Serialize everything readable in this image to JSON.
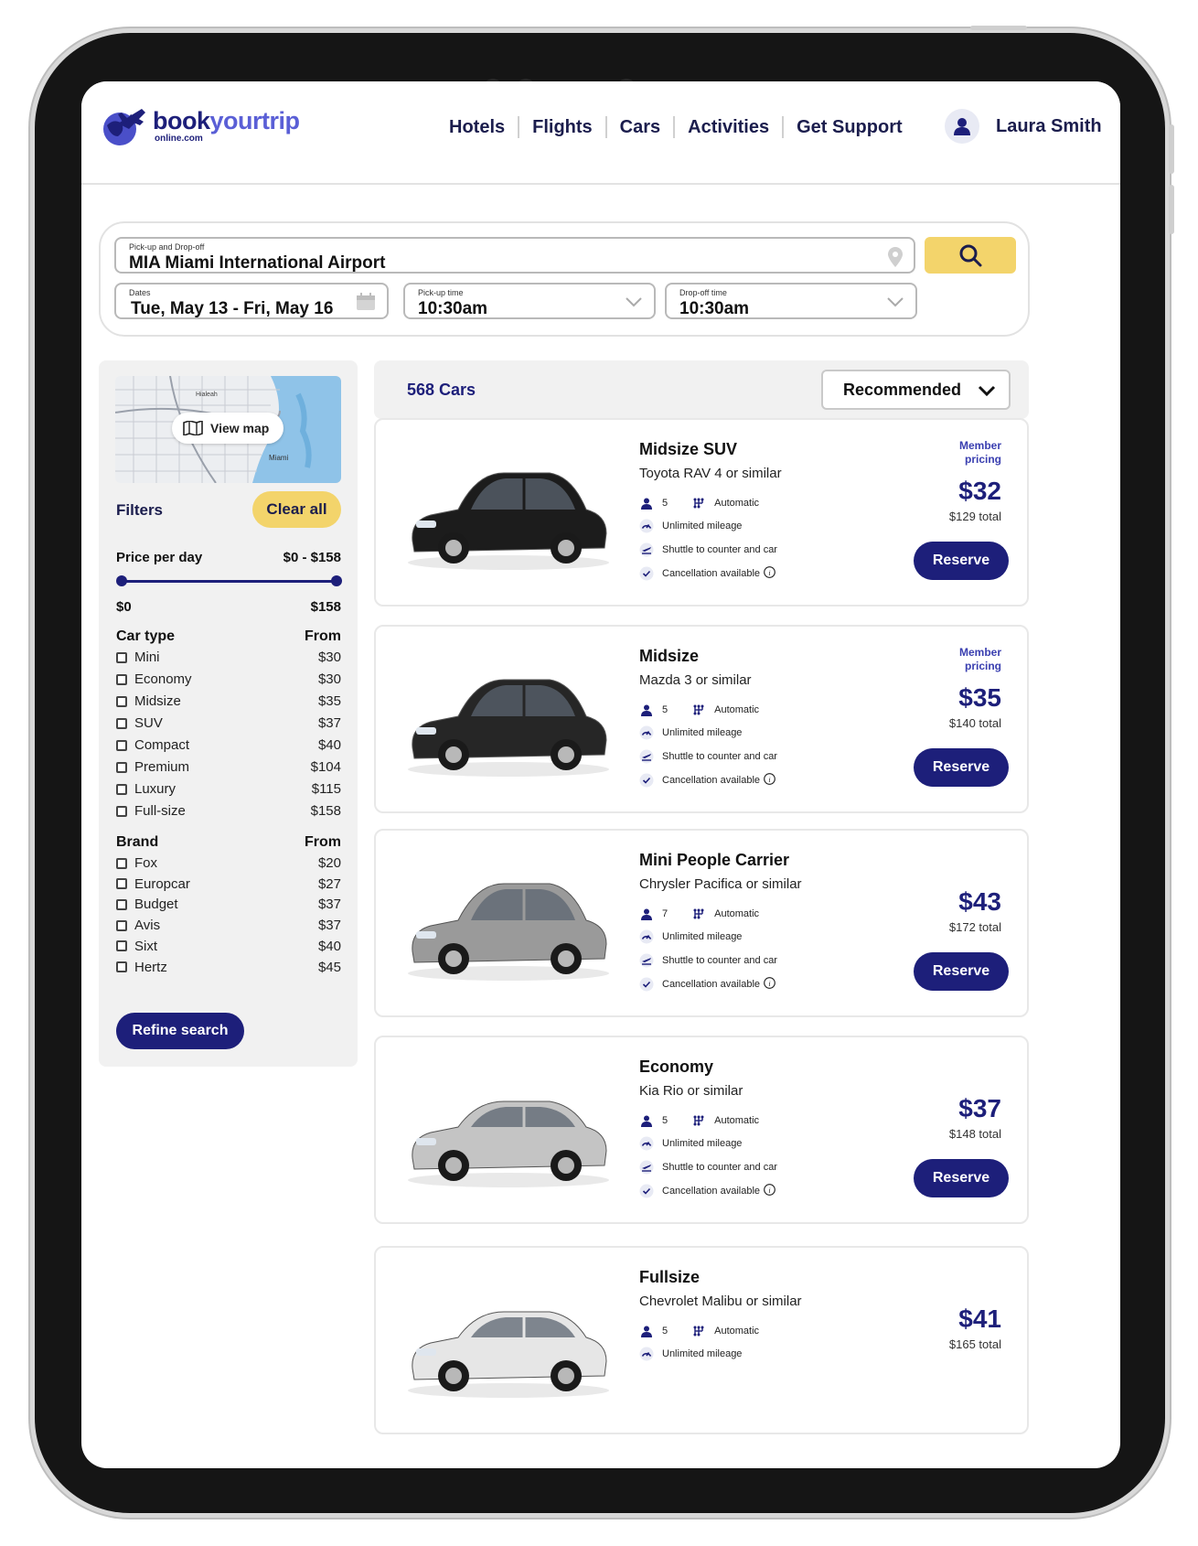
{
  "header": {
    "logo_main": "book",
    "logo_accent": "your",
    "logo_trip": "trip",
    "logo_sub": "online.com",
    "nav": [
      "Hotels",
      "Flights",
      "Cars",
      "Activities",
      "Get Support"
    ],
    "user_name": "Laura Smith"
  },
  "search": {
    "location_label": "Pick-up and Drop-off",
    "location_value": "MIA Miami International Airport",
    "dates_label": "Dates",
    "dates_value": "Tue, May 13 - Fri, May 16",
    "pickup_label": "Pick-up time",
    "pickup_value": "10:30am",
    "dropoff_label": "Drop-off time",
    "dropoff_value": "10:30am"
  },
  "sidebar": {
    "map_labels": [
      "Hialeah",
      "Miami"
    ],
    "view_map": "View map",
    "filters_title": "Filters",
    "clear_all": "Clear all",
    "price_label": "Price per day",
    "price_range": "$0 - $158",
    "price_min": "$0",
    "price_max": "$158",
    "car_type_head": "Car type",
    "brand_head": "Brand",
    "from_label": "From",
    "car_types": [
      {
        "label": "Mini",
        "price": "$30"
      },
      {
        "label": "Economy",
        "price": "$30"
      },
      {
        "label": "Midsize",
        "price": "$35"
      },
      {
        "label": "SUV",
        "price": "$37"
      },
      {
        "label": "Compact",
        "price": "$40"
      },
      {
        "label": "Premium",
        "price": "$104"
      },
      {
        "label": "Luxury",
        "price": "$115"
      },
      {
        "label": "Full-size",
        "price": "$158"
      }
    ],
    "brands": [
      {
        "label": "Fox",
        "price": "$20"
      },
      {
        "label": "Europcar",
        "price": "$27"
      },
      {
        "label": "Budget",
        "price": "$37"
      },
      {
        "label": "Avis",
        "price": "$37"
      },
      {
        "label": "Sixt",
        "price": "$40"
      },
      {
        "label": "Hertz",
        "price": "$45"
      }
    ],
    "refine": "Refine search"
  },
  "results": {
    "count": "568 Cars",
    "sort": "Recommended",
    "reserve_label": "Reserve",
    "member_line1": "Member",
    "member_line2": "pricing",
    "feature_labels": {
      "transmission": "Automatic",
      "mileage": "Unlimited mileage",
      "shuttle": "Shuttle to counter and car",
      "cancel": "Cancellation available"
    },
    "cars": [
      {
        "title": "Midsize SUV",
        "sub": "Toyota RAV 4 or similar",
        "seats": "5",
        "price": "$32",
        "total": "$129 total",
        "member": true,
        "color": "#1c1c1c"
      },
      {
        "title": "Midsize",
        "sub": "Mazda 3 or similar",
        "seats": "5",
        "price": "$35",
        "total": "$140 total",
        "member": true,
        "color": "#262626"
      },
      {
        "title": "Mini People Carrier",
        "sub": "Chrysler Pacifica or similar",
        "seats": "7",
        "price": "$43",
        "total": "$172 total",
        "member": false,
        "color": "#9a9a9a"
      },
      {
        "title": "Economy",
        "sub": "Kia Rio or similar",
        "seats": "5",
        "price": "$37",
        "total": "$148 total",
        "member": false,
        "color": "#c4c4c4"
      },
      {
        "title": "Fullsize",
        "sub": "Chevrolet Malibu or similar",
        "seats": "5",
        "price": "$41",
        "total": "$165 total",
        "member": false,
        "color": "#e6e6e6"
      }
    ]
  },
  "colors": {
    "navy": "#1d1f7a",
    "accent_yellow": "#f3d46b",
    "panel_gray": "#f1f1f1"
  }
}
